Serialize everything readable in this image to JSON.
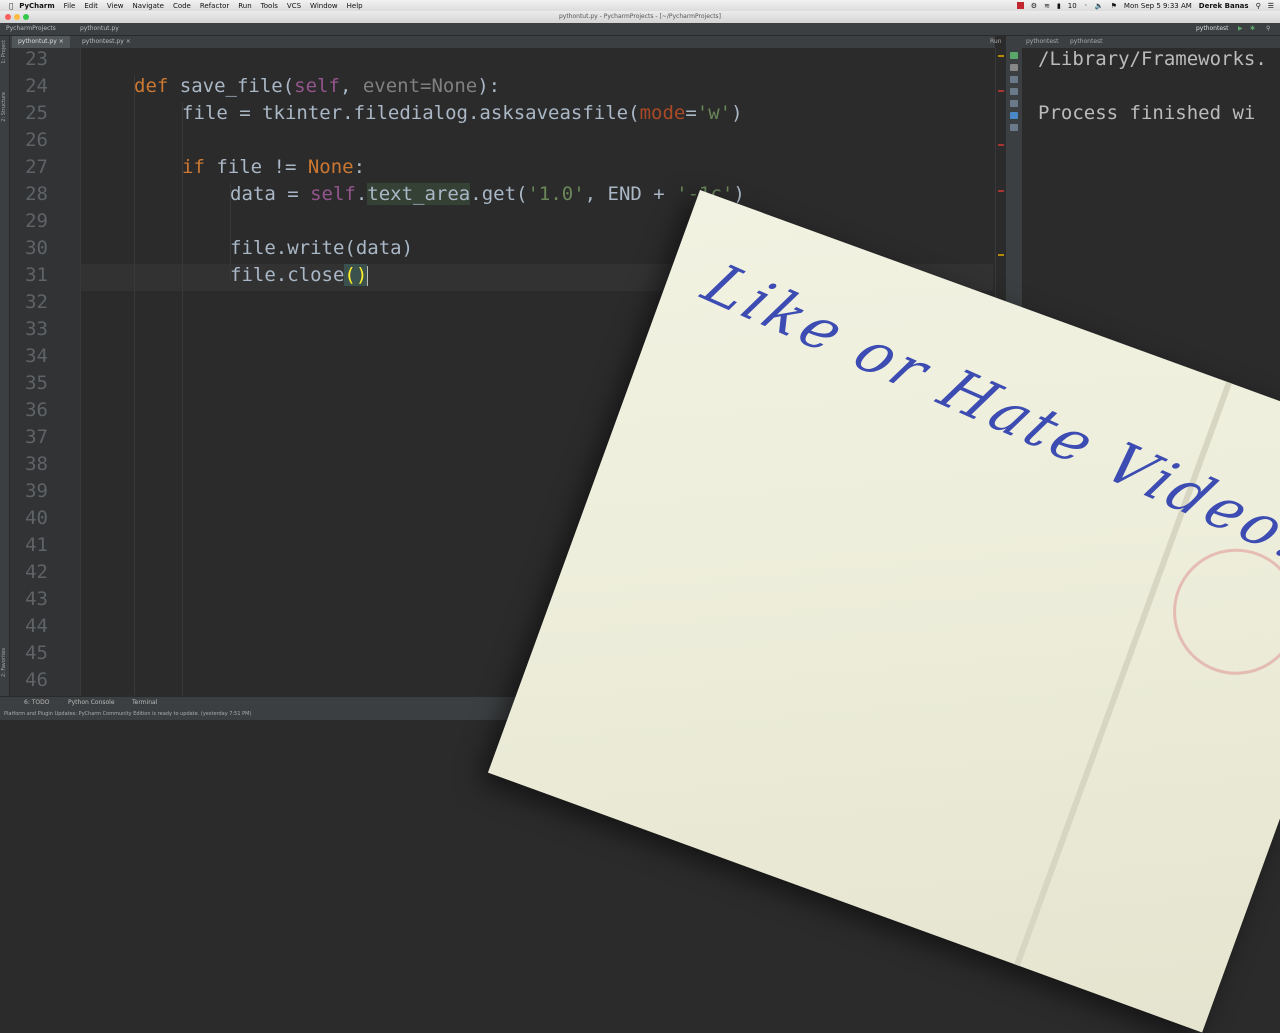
{
  "menubar": {
    "app_name": "PyCharm",
    "menus": [
      "File",
      "Edit",
      "View",
      "Navigate",
      "Code",
      "Refactor",
      "Run",
      "Tools",
      "VCS",
      "Window",
      "Help"
    ],
    "battery": "10",
    "datetime": "Mon Sep 5  9:33 AM",
    "user": "Derek Banas"
  },
  "window": {
    "title": "pythontut.py - PycharmProjects - [~/PycharmProjects]"
  },
  "navbar": {
    "crumbs": [
      "PycharmProjects",
      "pythontut.py"
    ],
    "run_config": "pythontest"
  },
  "tabs": [
    {
      "label": "pythontut.py",
      "active": true
    },
    {
      "label": "pythontest.py",
      "active": false
    }
  ],
  "side_tools": {
    "project": "1: Project",
    "structure": "2: Structure",
    "favorites": "2: Favorites"
  },
  "editor": {
    "line_numbers": [
      "23",
      "24",
      "25",
      "26",
      "27",
      "28",
      "29",
      "30",
      "31",
      "32",
      "33",
      "34",
      "35",
      "36",
      "37",
      "38",
      "39",
      "40",
      "41",
      "42",
      "43",
      "44",
      "45",
      "46"
    ]
  },
  "run_panel": {
    "label": "Run",
    "tabs": [
      "pythontest",
      "pythontest"
    ],
    "console_lines": [
      "/Library/Frameworks.",
      "",
      "Process finished wi"
    ]
  },
  "bottom_tools": {
    "todo": "6: TODO",
    "python_console": "Python Console",
    "terminal": "Terminal"
  },
  "status": {
    "message": "Platform and Plugin Updates: PyCharm Community Edition is ready to update. (yesterday 7:51 PM)"
  },
  "overlay": {
    "handwriting": "Like or Hate Video?"
  },
  "colors": {
    "editor_bg": "#2b2b2b",
    "keyword": "#cc7832",
    "self": "#94558d",
    "string": "#6a8759",
    "param": "#aa4926",
    "handwriting_ink": "#3c4cb2",
    "card_paper": "#eeeedc"
  }
}
